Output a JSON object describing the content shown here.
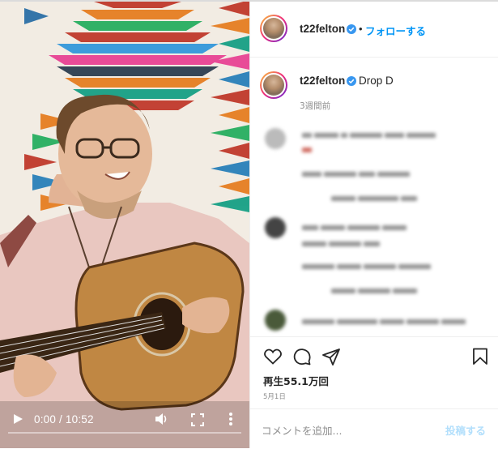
{
  "post": {
    "username": "t22felton",
    "separator": "•",
    "follow_label": "フォローする",
    "caption_user": "t22felton",
    "caption_text": "Drop D",
    "time_ago": "3週間前",
    "views": "再生55.1万回",
    "date": "5月1日",
    "comment_placeholder": "コメントを追加...",
    "post_label": "投稿する"
  },
  "video": {
    "time_display": "0:00 / 10:52",
    "progress": 0
  },
  "icons": {
    "play": "play-icon",
    "volume": "volume-icon",
    "fullscreen": "fullscreen-icon",
    "more": "more-vertical-icon",
    "verified": "verified-badge-icon",
    "like": "heart-icon",
    "comment": "comment-icon",
    "share": "share-icon",
    "save": "bookmark-icon"
  },
  "colors": {
    "accent": "#0095f6",
    "verified": "#3897f0",
    "text": "#262626",
    "muted": "#8e8e8e",
    "post_disabled": "#b2dffc"
  }
}
